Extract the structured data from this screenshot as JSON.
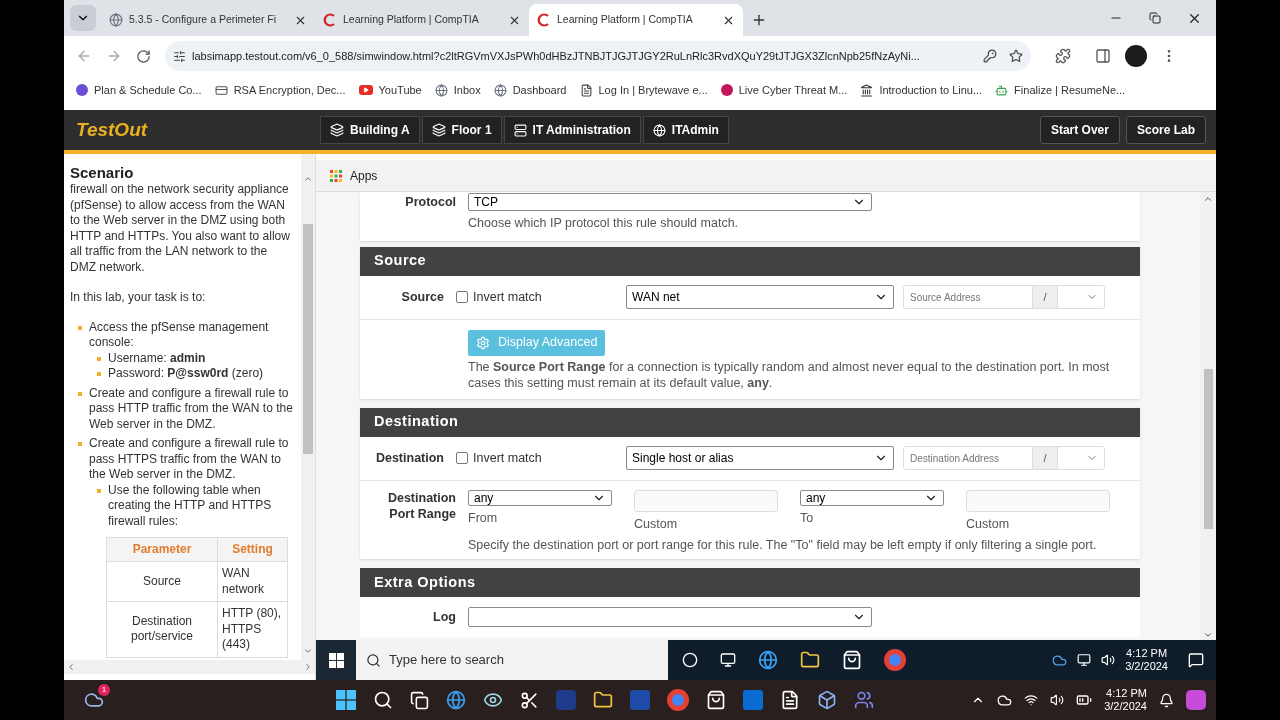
{
  "browser": {
    "tabs": [
      {
        "title": "5.3.5 - Configure a Perimeter Fi",
        "selected": false
      },
      {
        "title": "Learning Platform | CompTIA",
        "selected": false
      },
      {
        "title": "Learning Platform | CompTIA",
        "selected": true
      }
    ],
    "url": "labsimapp.testout.com/v6_0_588/simwindow.html?c2ltRGVmVXJsPWh0dHBzJTNBJTJGJTJGY2RuLnRlc3RvdXQuY29tJTJGX3ZlcnNpb25fNzAyNi...",
    "bookmarks": [
      "Plan & Schedule Co...",
      "RSA Encryption, Dec...",
      "YouTube",
      "Inbox",
      "Dashboard",
      "Log In | Brytewave e...",
      "Live Cyber Threat M...",
      "Introduction to Linu...",
      "Finalize | ResumeNe..."
    ]
  },
  "lab": {
    "logo": "TestOut",
    "breadcrumbs": [
      "Building A",
      "Floor 1",
      "IT Administration",
      "ITAdmin"
    ],
    "buttons": [
      "Start Over",
      "Score Lab"
    ]
  },
  "scenario": {
    "title": "Scenario",
    "intro": "firewall on the network security appliance (pfSense) to allow access from the WAN to the Web server in the DMZ using both HTTP and HTTPs. You also want to allow all traffic from the LAN network to the DMZ network.",
    "task_lead": "In this lab, your task is to:",
    "tasks": [
      {
        "text": "Access the pfSense management console:",
        "children": [
          {
            "text": "Username: **admin**"
          },
          {
            "text": "Password: **P@ssw0rd** (zero)"
          }
        ]
      },
      {
        "text": "Create and configure a firewall rule to pass HTTP traffic from the WAN to the Web server in the DMZ."
      },
      {
        "text": "Create and configure a firewall rule to pass HTTPS traffic from the WAN to the Web server in the DMZ.",
        "children": [
          {
            "text": "Use the following table when creating the HTTP and HTTPS firewall rules:"
          }
        ]
      }
    ],
    "table": {
      "columns": [
        "Parameter",
        "Setting"
      ],
      "rows": [
        [
          "Source",
          "WAN network"
        ],
        [
          "Destination port/service",
          "HTTP (80), HTTPS (443)"
        ]
      ]
    }
  },
  "vm": {
    "apps_label": "Apps",
    "protocol": {
      "label": "Protocol",
      "value": "TCP",
      "help": "Choose which IP protocol this rule should match."
    },
    "source": {
      "title": "Source",
      "label": "Source",
      "invert": {
        "label": "Invert match",
        "checked": false
      },
      "type_value": "WAN net",
      "address_placeholder": "Source Address",
      "slash": "/",
      "advanced_button": "Display Advanced",
      "help": "The **Source Port Range** for a connection is typically random and almost never equal to the destination port. In most cases this setting must remain at its default value, **any**."
    },
    "destination": {
      "title": "Destination",
      "label": "Destination",
      "invert": {
        "label": "Invert match",
        "checked": false
      },
      "type_value": "Single host or alias",
      "address_placeholder": "Destination Address",
      "slash": "/",
      "port_range": {
        "label": "Destination Port Range",
        "from_value": "any",
        "from_caption": "From",
        "from_custom_caption": "Custom",
        "to_value": "any",
        "to_caption": "To",
        "to_custom_caption": "Custom"
      },
      "help": "Specify the destination port or port range for this rule. The \"To\" field may be left empty if only filtering a single port."
    },
    "extra_options": {
      "title": "Extra Options",
      "log_label": "Log"
    },
    "taskbar": {
      "search_placeholder": "Type here to search",
      "time": "4:12 PM",
      "date": "3/2/2024"
    }
  },
  "host_taskbar": {
    "badge": "1",
    "time": "4:12 PM",
    "date": "3/2/2024"
  }
}
